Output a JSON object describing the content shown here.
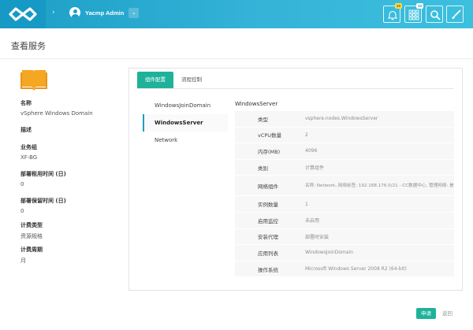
{
  "header": {
    "user_name": "Yacmp Admin",
    "badges": {
      "bell": "33",
      "grid": "10"
    }
  },
  "page": {
    "title": "查看服务"
  },
  "service": {
    "fields": [
      {
        "label": "名称",
        "value": "vSphere Windows Domain"
      },
      {
        "label": "描述",
        "value": ""
      },
      {
        "label": "业务组",
        "value": "XF-BG"
      },
      {
        "label": "部署租用时间 (日)",
        "value": "0"
      },
      {
        "label": "部署保留时间 (日)",
        "value": "0"
      },
      {
        "label": "计费类型",
        "value": "资源规格"
      },
      {
        "label": "计费周期",
        "value": "月"
      }
    ]
  },
  "tabs": [
    "组件配置",
    "流程控制"
  ],
  "components": [
    "WindowsJoinDomain",
    "WindowsServer",
    "Network"
  ],
  "detail": {
    "title": "WindowsServer",
    "rows": [
      {
        "k": "类型",
        "v": "vsphere.nodes.WindowsServer"
      },
      {
        "k": "vCPU数量",
        "v": "2"
      },
      {
        "k": "内存(MB)",
        "v": "4096"
      },
      {
        "k": "类别",
        "v": "计算组件"
      },
      {
        "k": "网络组件",
        "v": "名称: Network, 网络标签: 192.168.176.0/21 - CC数据中心, 管理网络: 是"
      },
      {
        "k": "实例数量",
        "v": "1"
      },
      {
        "k": "启用监控",
        "v": "未启用"
      },
      {
        "k": "安装代理",
        "v": "部署时安装"
      },
      {
        "k": "应用列表",
        "v": "WindowsJoinDomain"
      },
      {
        "k": "操作系统",
        "v": "Microsoft Windows Server 2008 R2 (64-bit)"
      }
    ]
  },
  "actions": {
    "apply": "申请",
    "back": "返回"
  },
  "colors": {
    "header": "#1b9ec6",
    "accent": "#1fb29a",
    "book": "#f5a623"
  },
  "icons": [
    "infinity-logo-icon",
    "chevron-right-icon",
    "user-avatar-icon",
    "caret-down-icon",
    "bell-icon",
    "grid-icon",
    "search-icon",
    "brush-icon",
    "book-icon"
  ]
}
